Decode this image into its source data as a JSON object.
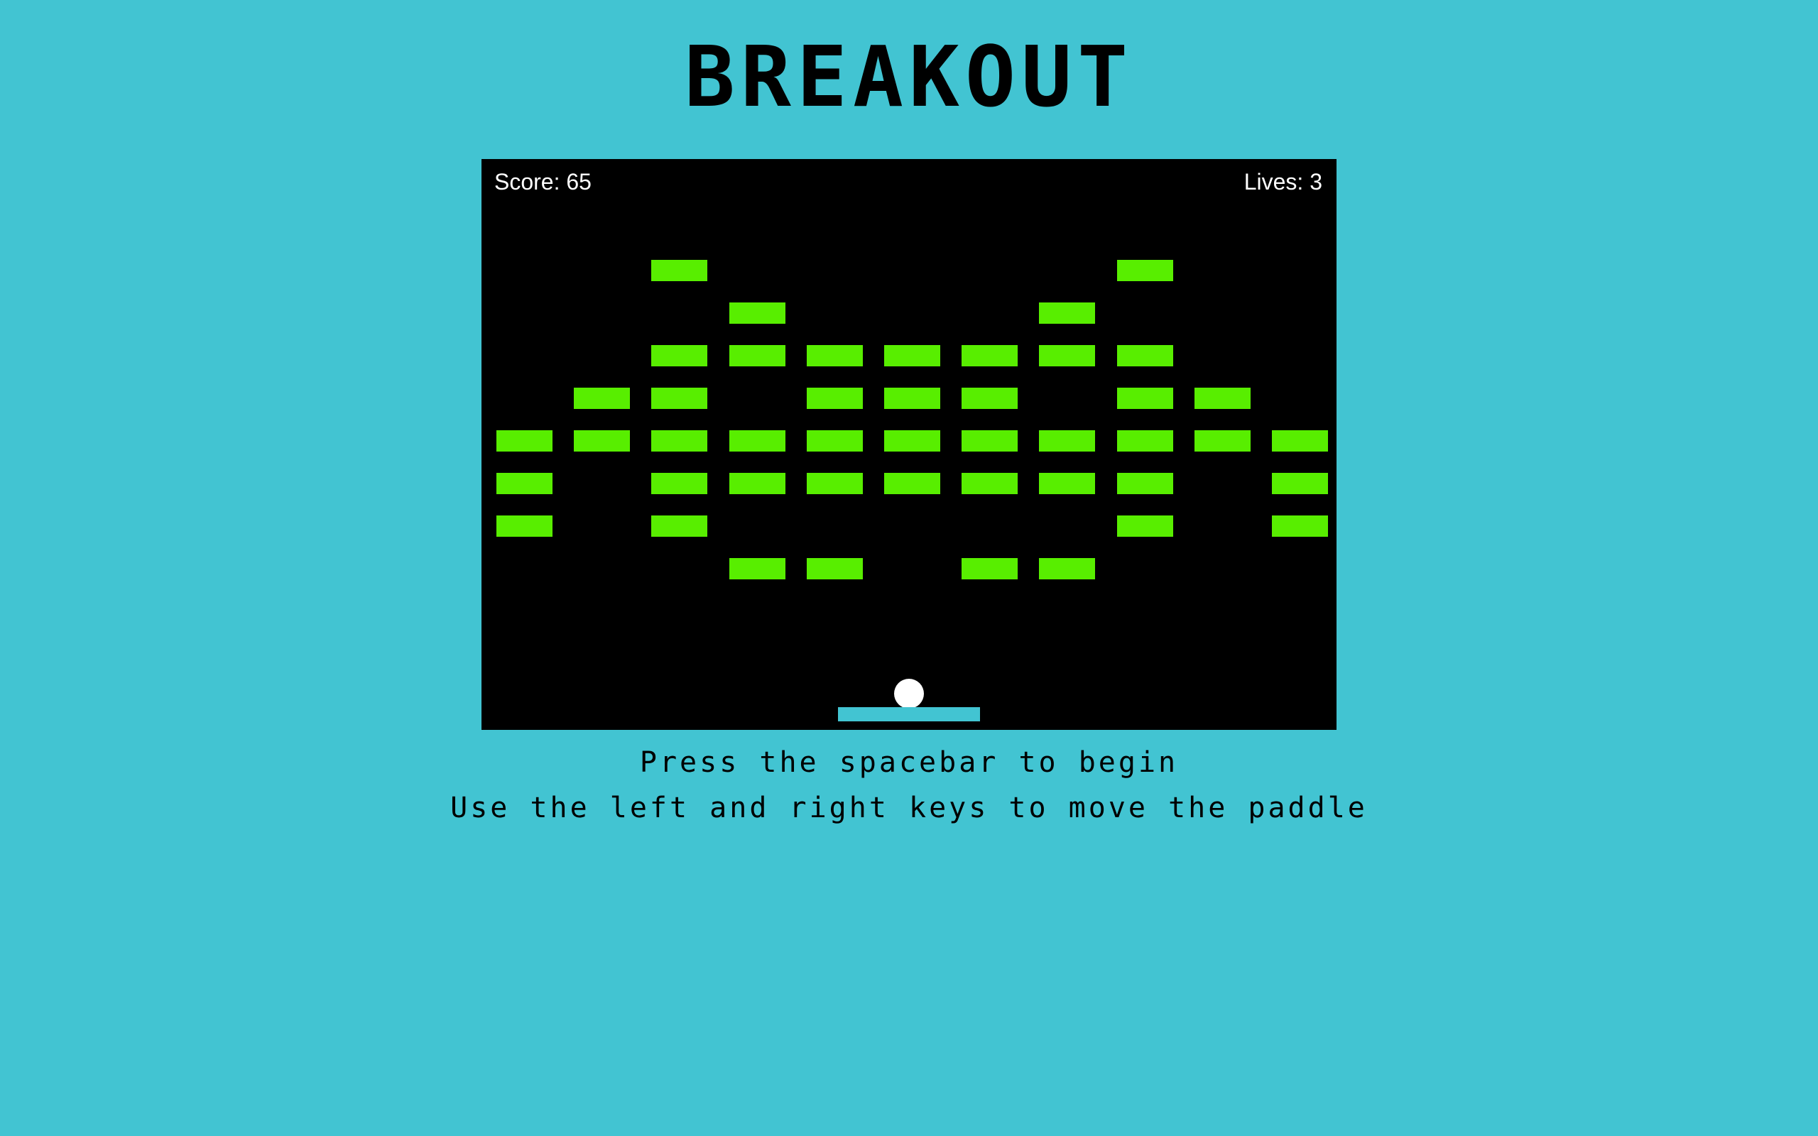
{
  "title": "BREAKOUT",
  "hud": {
    "score": "Score: 65",
    "lives": "Lives: 3"
  },
  "instructions": {
    "line1": "Press the spacebar to begin",
    "line2": "Use the left and right keys to move the paddle"
  },
  "colors": {
    "background": "#42c4d2",
    "board": "#000000",
    "brick": "#58ee00",
    "paddle": "#42c4d2",
    "ball": "#ffffff"
  },
  "bricks": {
    "columns": 11,
    "rows": 8,
    "grid": [
      [
        0,
        0,
        1,
        0,
        0,
        0,
        0,
        0,
        1,
        0,
        0
      ],
      [
        0,
        0,
        0,
        1,
        0,
        0,
        0,
        1,
        0,
        0,
        0
      ],
      [
        0,
        0,
        1,
        1,
        1,
        1,
        1,
        1,
        1,
        0,
        0
      ],
      [
        0,
        1,
        1,
        0,
        1,
        1,
        1,
        0,
        1,
        1,
        0
      ],
      [
        1,
        1,
        1,
        1,
        1,
        1,
        1,
        1,
        1,
        1,
        1
      ],
      [
        1,
        0,
        1,
        1,
        1,
        1,
        1,
        1,
        1,
        0,
        1
      ],
      [
        1,
        0,
        1,
        0,
        0,
        0,
        0,
        0,
        1,
        0,
        1
      ],
      [
        0,
        0,
        0,
        1,
        1,
        0,
        1,
        1,
        0,
        0,
        0
      ]
    ]
  }
}
